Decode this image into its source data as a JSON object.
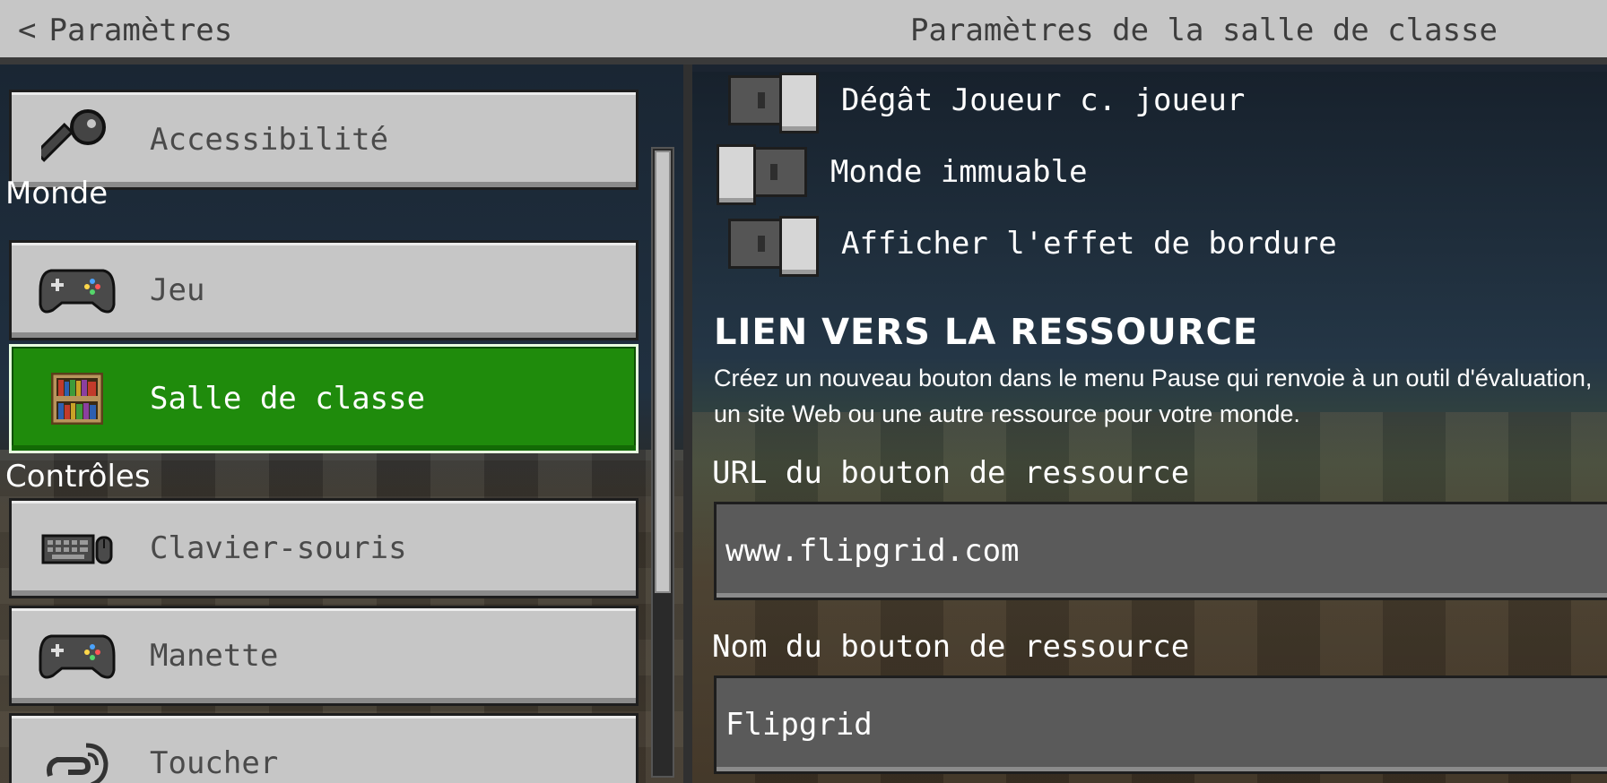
{
  "header": {
    "back_label": "Paramètres",
    "title": "Paramètres de la salle de classe"
  },
  "sidebar": {
    "accessibility": {
      "label": "Accessibilité",
      "icon": "key-icon"
    },
    "sections": {
      "world": "Monde",
      "controls": "Contrôles"
    },
    "items": [
      {
        "label": "Jeu",
        "icon": "gamepad-icon"
      },
      {
        "label": "Salle de classe",
        "icon": "bookshelf-icon",
        "active": true
      },
      {
        "label": "Clavier-souris",
        "icon": "keyboard-mouse-icon"
      },
      {
        "label": "Manette",
        "icon": "gamepad-icon"
      },
      {
        "label": "Toucher",
        "icon": "touch-hand-icon"
      }
    ],
    "active_color": "#1f8b0c"
  },
  "settings": {
    "toggles": [
      {
        "label": "Dégât Joueur c. joueur",
        "state": "on"
      },
      {
        "label": "Monde immuable",
        "state": "off"
      },
      {
        "label": "Afficher l'effet de bordure",
        "state": "on"
      }
    ],
    "resource_section": {
      "heading": "LIEN VERS LA RESSOURCE",
      "description": "Créez un nouveau bouton dans le menu Pause qui renvoie à un outil d'évaluation, un site Web ou une autre ressource pour votre monde."
    },
    "url_field": {
      "label": "URL du bouton de ressource",
      "value": "www.flipgrid.com"
    },
    "name_field": {
      "label": "Nom du bouton de ressource",
      "value": "Flipgrid"
    }
  }
}
